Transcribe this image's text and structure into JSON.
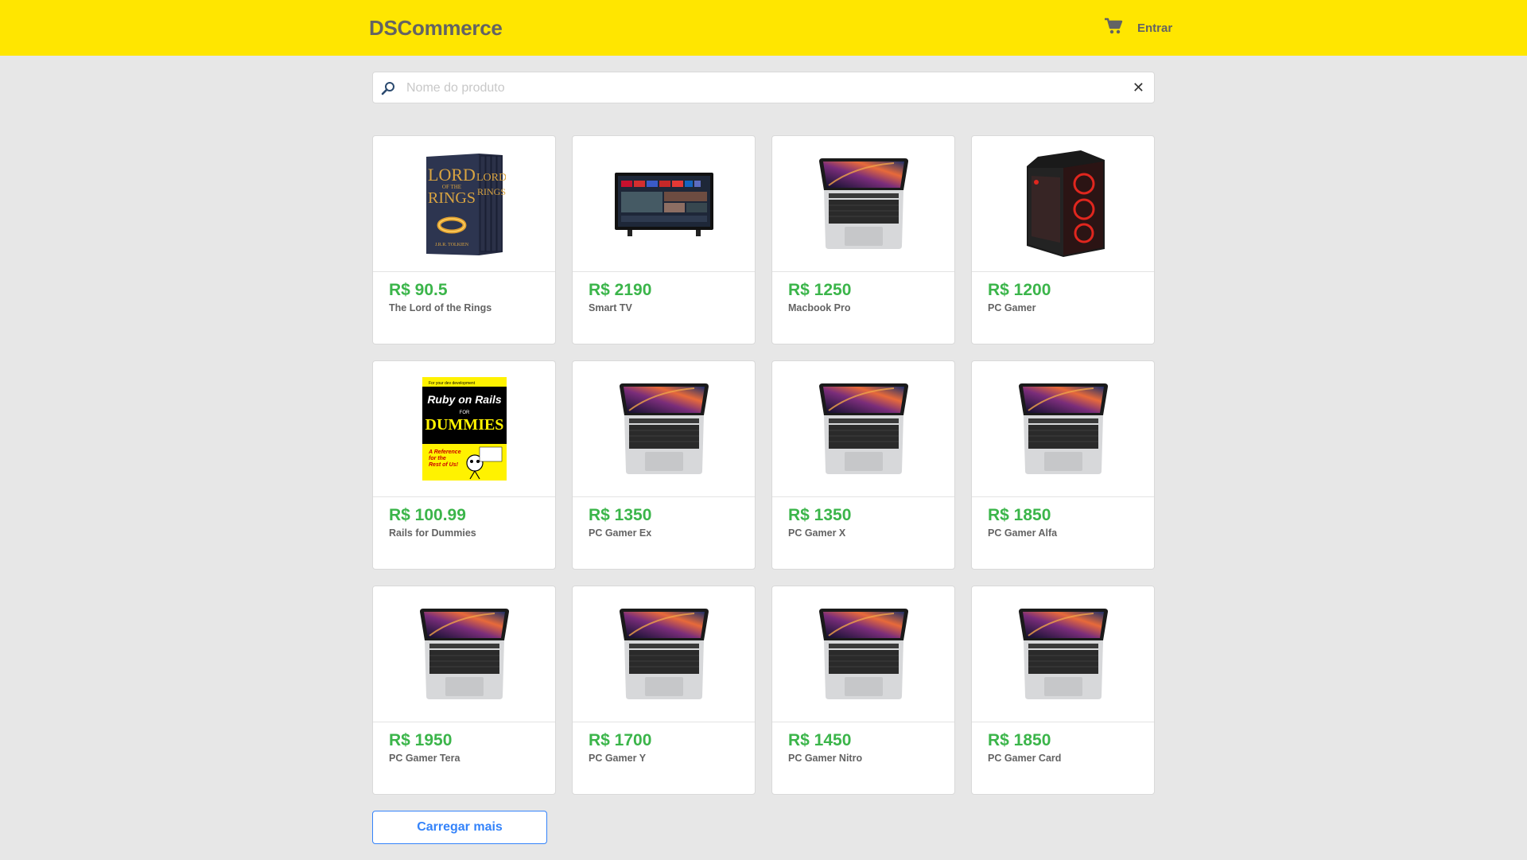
{
  "header": {
    "brand": "DSCommerce",
    "login_label": "Entrar",
    "cart_icon": "cart-icon"
  },
  "search": {
    "placeholder": "Nome do produto",
    "value": "",
    "clear_label": "✕"
  },
  "products": [
    {
      "price": "R$ 90.5",
      "name": "The Lord of the Rings",
      "image": "book-lotr"
    },
    {
      "price": "R$ 2190",
      "name": "Smart TV",
      "image": "tv"
    },
    {
      "price": "R$ 1250",
      "name": "Macbook Pro",
      "image": "laptop"
    },
    {
      "price": "R$ 1200",
      "name": "PC Gamer",
      "image": "pc-tower"
    },
    {
      "price": "R$ 100.99",
      "name": "Rails for Dummies",
      "image": "book-dummies"
    },
    {
      "price": "R$ 1350",
      "name": "PC Gamer Ex",
      "image": "laptop"
    },
    {
      "price": "R$ 1350",
      "name": "PC Gamer X",
      "image": "laptop"
    },
    {
      "price": "R$ 1850",
      "name": "PC Gamer Alfa",
      "image": "laptop"
    },
    {
      "price": "R$ 1950",
      "name": "PC Gamer Tera",
      "image": "laptop"
    },
    {
      "price": "R$ 1700",
      "name": "PC Gamer Y",
      "image": "laptop"
    },
    {
      "price": "R$ 1450",
      "name": "PC Gamer Nitro",
      "image": "laptop"
    },
    {
      "price": "R$ 1850",
      "name": "PC Gamer Card",
      "image": "laptop"
    }
  ],
  "load_more_label": "Carregar mais",
  "colors": {
    "header_bg": "#ffe600",
    "price": "#3bb54a",
    "accent": "#3483fa",
    "page_bg": "#e7e7e7"
  }
}
